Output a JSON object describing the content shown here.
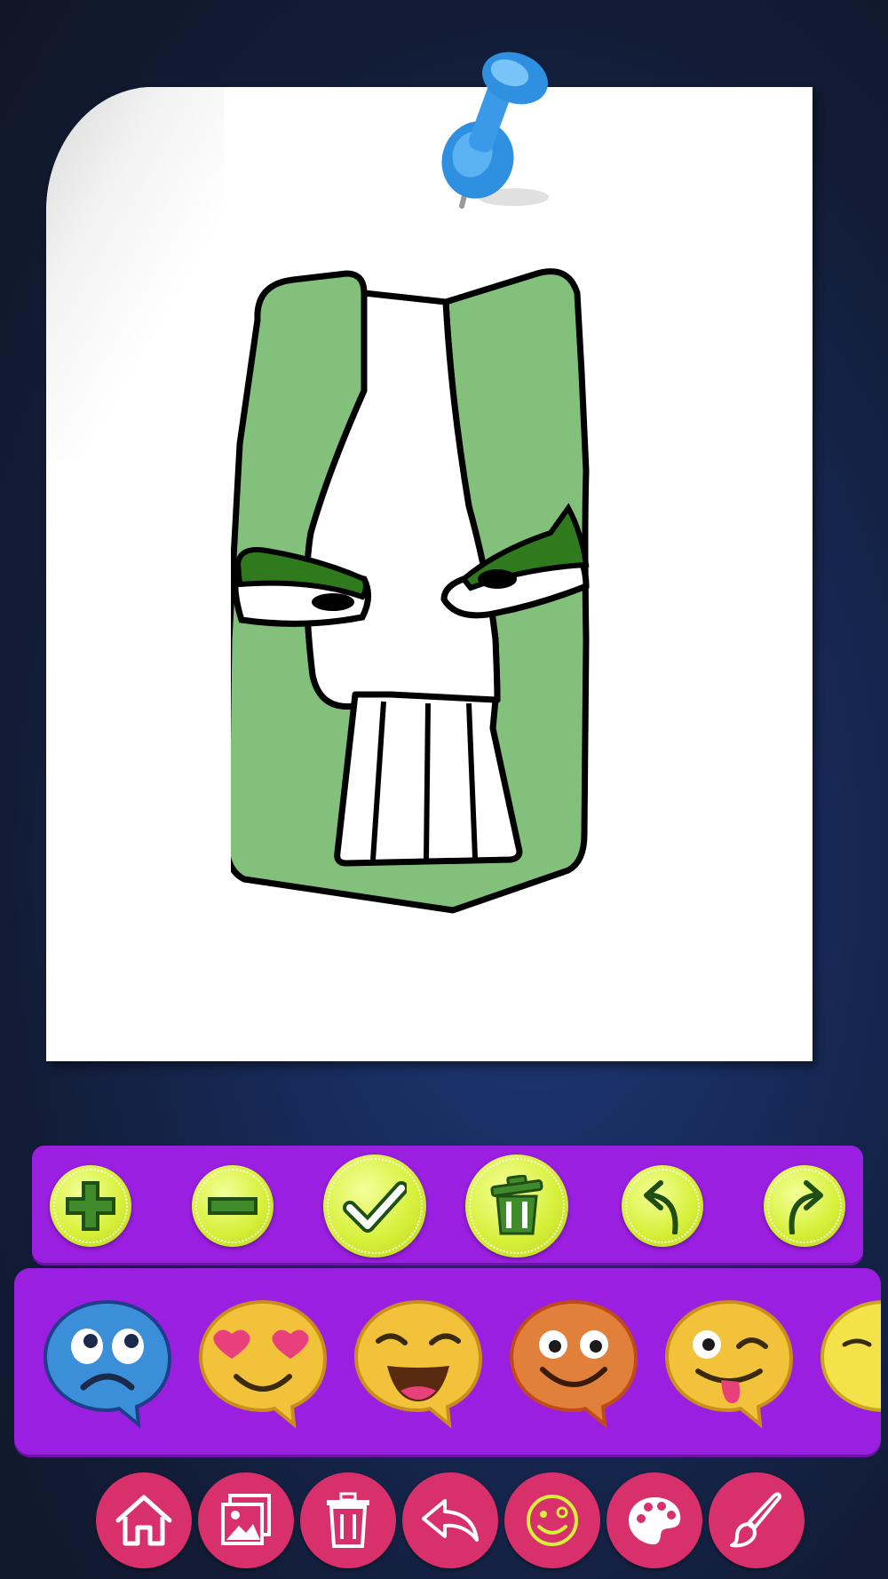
{
  "canvas": {
    "letter_fill": "#82c07c",
    "outline": "#000000",
    "brow_fill": "#2e7a1c"
  },
  "toolbar": {
    "buttons": [
      {
        "icon": "plus-icon"
      },
      {
        "icon": "minus-icon"
      },
      {
        "icon": "checkmark-icon"
      },
      {
        "icon": "trash-icon"
      },
      {
        "icon": "undo-arrow-icon"
      },
      {
        "icon": "redo-arrow-icon"
      }
    ],
    "accent": "#9a1fe0",
    "button_color": "#d7f03a"
  },
  "emoji_picker": {
    "items": [
      {
        "icon": "worried-blue-emoji"
      },
      {
        "icon": "heart-eyes-emoji"
      },
      {
        "icon": "laughing-emoji"
      },
      {
        "icon": "surprised-orange-emoji"
      },
      {
        "icon": "wink-tongue-emoji"
      },
      {
        "icon": "partial-emoji"
      }
    ]
  },
  "bottom_nav": {
    "buttons": [
      {
        "icon": "home-icon"
      },
      {
        "icon": "gallery-icon"
      },
      {
        "icon": "trash-icon"
      },
      {
        "icon": "back-arrow-icon"
      },
      {
        "icon": "emoji-icon"
      },
      {
        "icon": "palette-icon"
      },
      {
        "icon": "brush-icon"
      }
    ],
    "button_color": "#d8306a"
  }
}
